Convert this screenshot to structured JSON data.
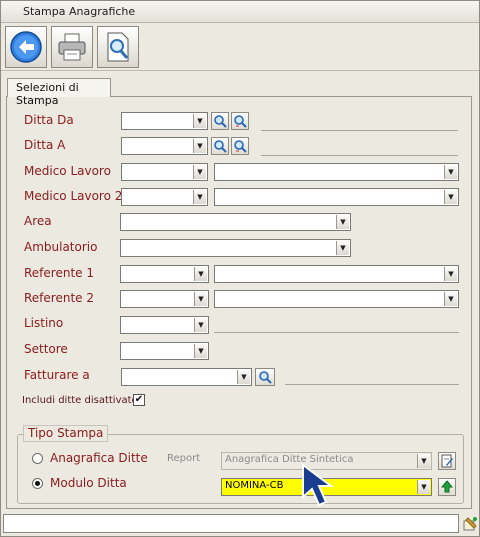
{
  "window": {
    "title": "Stampa Anagrafiche"
  },
  "toolbar": {
    "back_icon": "back-arrow-icon",
    "print_icon": "printer-icon",
    "preview_icon": "print-preview-icon"
  },
  "tabs": [
    {
      "label": "Selezioni di Stampa"
    }
  ],
  "fields": {
    "ditta_da": "Ditta Da",
    "ditta_a": "Ditta A",
    "medico_lavoro": "Medico Lavoro",
    "medico_lavoro_2": "Medico Lavoro 2",
    "area": "Area",
    "ambulatorio": "Ambulatorio",
    "referente_1": "Referente 1",
    "referente_2": "Referente 2",
    "listino": "Listino",
    "settore": "Settore",
    "fatturare_a": "Fatturare a",
    "includi": "Includi ditte disattivate"
  },
  "tipo_stampa": {
    "title": "Tipo Stampa",
    "option_anagrafica": "Anagrafica Ditte",
    "option_modulo": "Modulo Ditta",
    "selected": "Modulo Ditta",
    "report_label": "Report",
    "report_value": "Anagrafica Ditte Sintetica",
    "modulo_value": "NOMINA-CB"
  },
  "colors": {
    "label": "#8b1c1c",
    "highlight": "#ffff00",
    "accent": "#1f6fd1"
  }
}
